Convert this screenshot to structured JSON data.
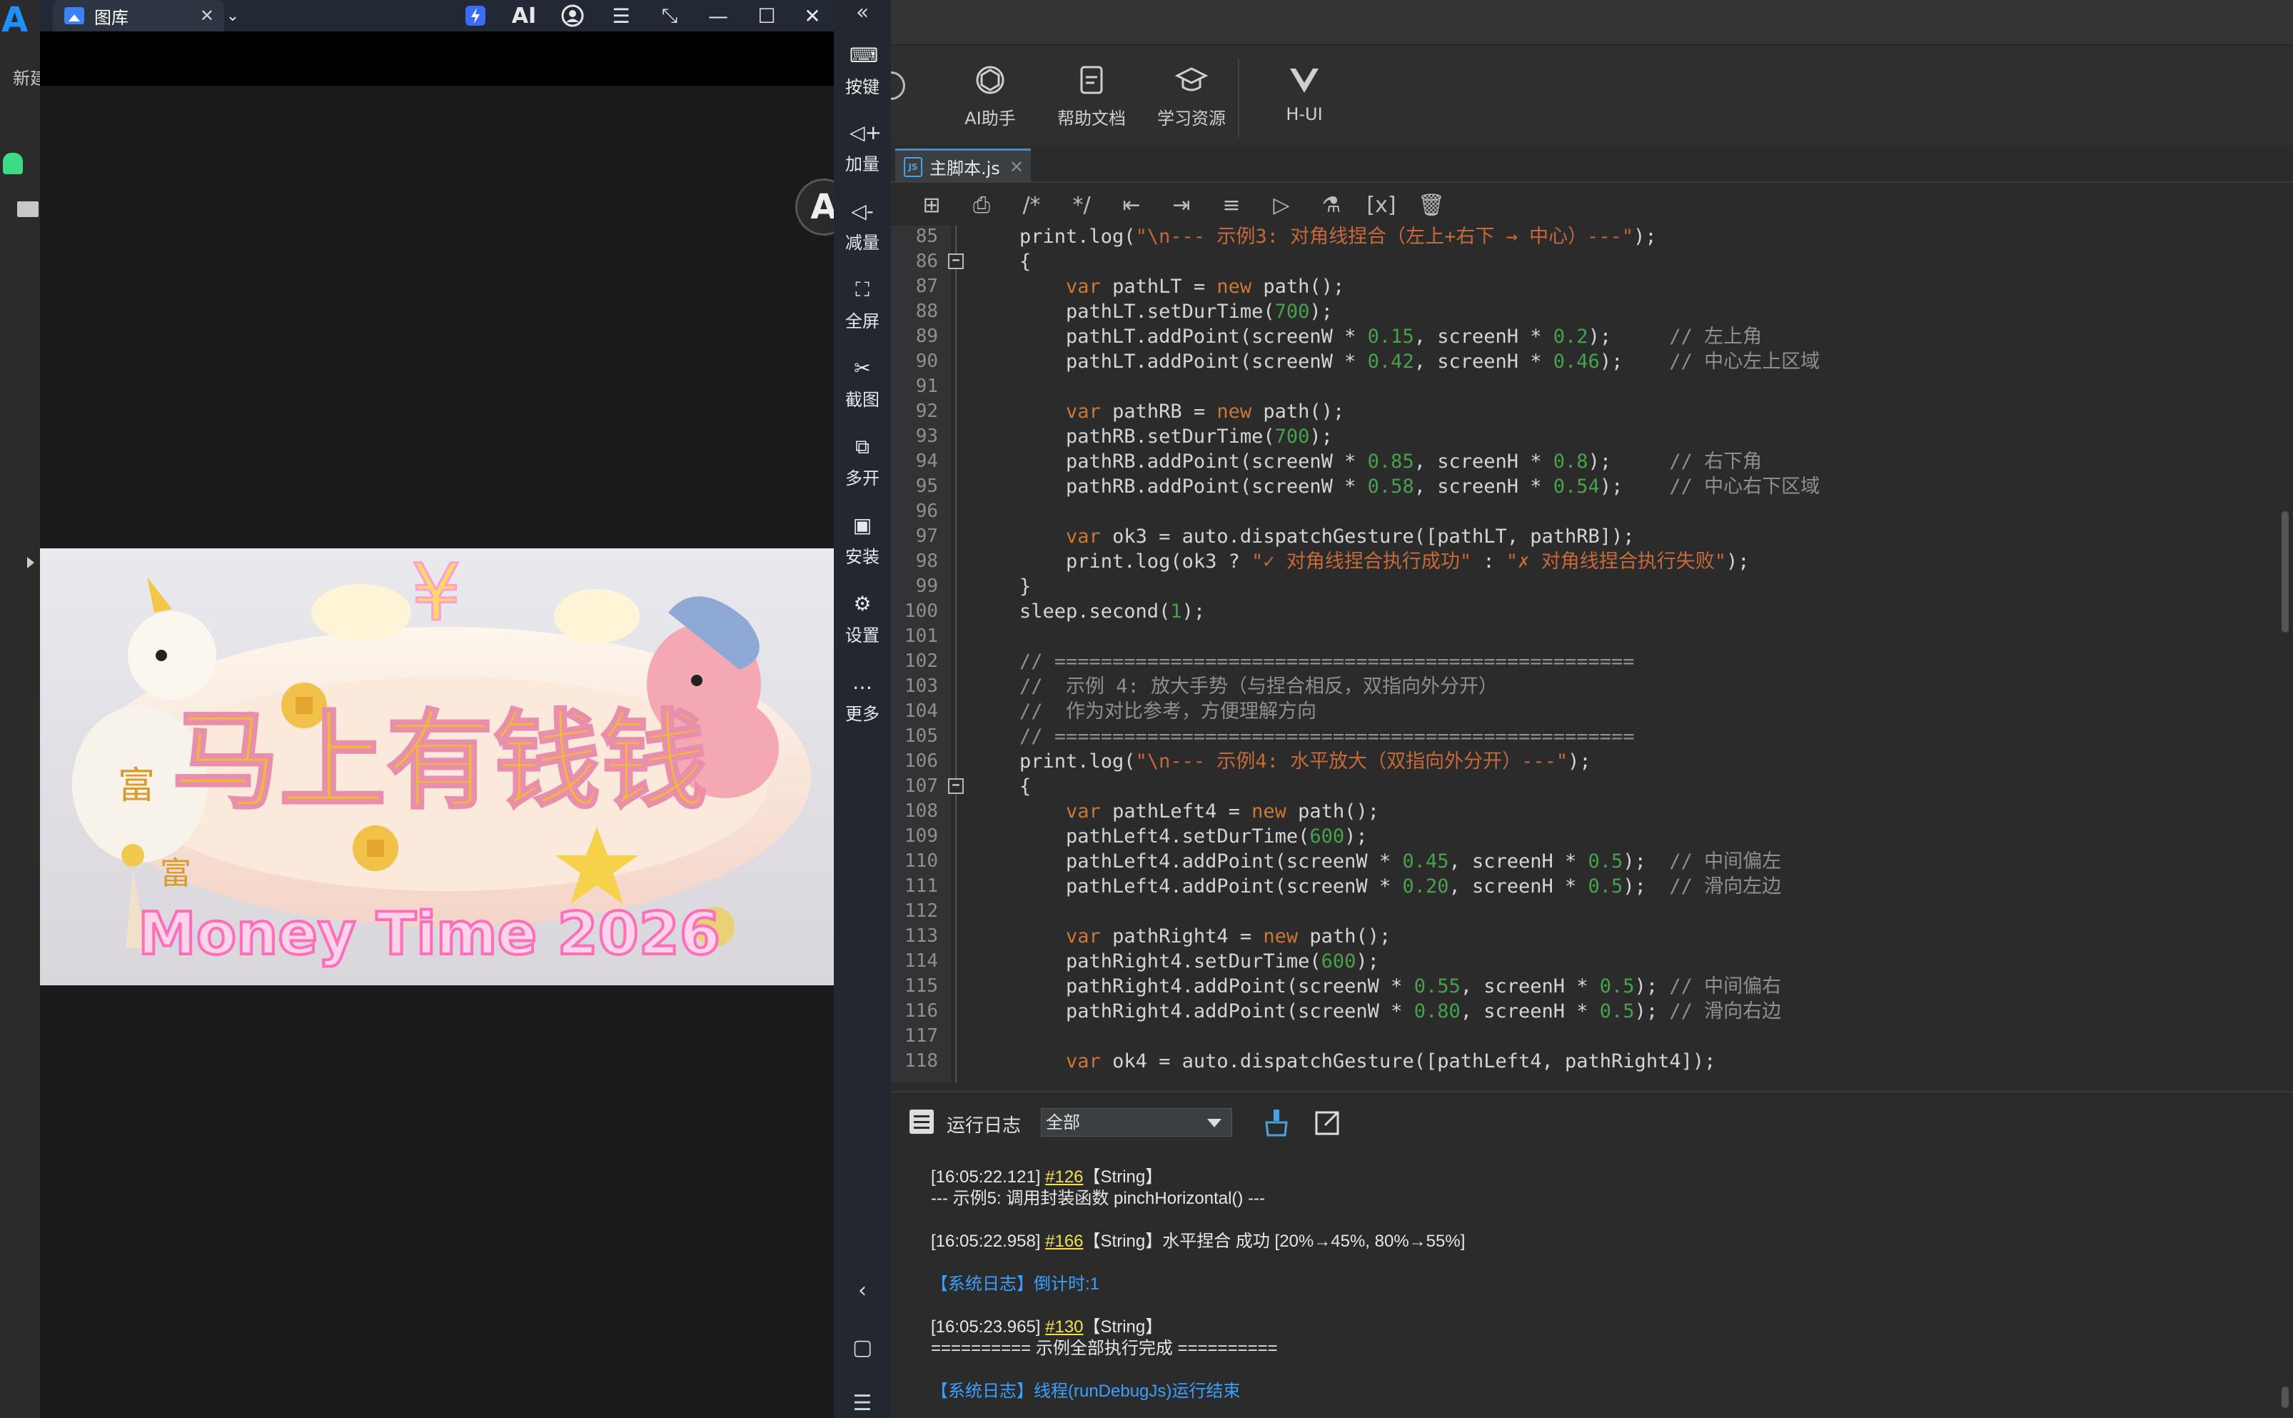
{
  "ide": {
    "logo": "A",
    "left_new_label": "新建",
    "toolbar": [
      {
        "label": "AI助手",
        "icon": "ai-assistant-icon"
      },
      {
        "label": "帮助文档",
        "icon": "document-icon"
      },
      {
        "label": "学习资源",
        "icon": "graduation-cap-icon"
      },
      {
        "label": "H-UI",
        "icon": "vue-icon"
      }
    ],
    "file_tab": "主脚本.js",
    "edit_toolbar_icons": [
      "add-icon",
      "print-icon",
      "comment-icon",
      "uncomment-icon",
      "outdent-icon",
      "indent-icon",
      "format-icon",
      "run-icon",
      "test-icon",
      "variable-icon",
      "delete-icon"
    ]
  },
  "emulator": {
    "tab_title": "图库",
    "side_items": [
      {
        "label": "按键",
        "icon": "keyboard-icon"
      },
      {
        "label": "加量",
        "icon": "volume-up-icon"
      },
      {
        "label": "减量",
        "icon": "volume-down-icon"
      },
      {
        "label": "全屏",
        "icon": "fullscreen-icon"
      },
      {
        "label": "截图",
        "icon": "scissors-icon"
      },
      {
        "label": "多开",
        "icon": "multi-instance-icon"
      },
      {
        "label": "安装",
        "icon": "apk-install-icon"
      },
      {
        "label": "设置",
        "icon": "settings-icon"
      },
      {
        "label": "更多",
        "icon": "more-icon"
      }
    ],
    "image_text": {
      "title": "马上有钱钱",
      "subtitle": "Money Time 2026",
      "fu": "富"
    }
  },
  "code": {
    "lines": [
      {
        "n": 85,
        "fold": false
      },
      {
        "n": 86,
        "fold": true
      },
      {
        "n": 87
      },
      {
        "n": 88
      },
      {
        "n": 89
      },
      {
        "n": 90
      },
      {
        "n": 91
      },
      {
        "n": 92
      },
      {
        "n": 93
      },
      {
        "n": 94
      },
      {
        "n": 95
      },
      {
        "n": 96
      },
      {
        "n": 97
      },
      {
        "n": 98
      },
      {
        "n": 99
      },
      {
        "n": 100
      },
      {
        "n": 101
      },
      {
        "n": 102
      },
      {
        "n": 103
      },
      {
        "n": 104
      },
      {
        "n": 105
      },
      {
        "n": 106
      },
      {
        "n": 107,
        "fold": true
      },
      {
        "n": 108
      },
      {
        "n": 109
      },
      {
        "n": 110
      },
      {
        "n": 111
      },
      {
        "n": 112
      },
      {
        "n": 113
      },
      {
        "n": 114
      },
      {
        "n": 115
      },
      {
        "n": 116
      },
      {
        "n": 117
      },
      {
        "n": 118
      }
    ],
    "text": [
      "print.log(\"\\n--- 示例3: 对角线捏合（左上+右下 → 中心）---\");",
      "{",
      "    var pathLT = new path();",
      "    pathLT.setDurTime(700);",
      "    pathLT.addPoint(screenW * 0.15, screenH * 0.2);     // 左上角",
      "    pathLT.addPoint(screenW * 0.42, screenH * 0.46);    // 中心左上区域",
      "",
      "    var pathRB = new path();",
      "    pathRB.setDurTime(700);",
      "    pathRB.addPoint(screenW * 0.85, screenH * 0.8);     // 右下角",
      "    pathRB.addPoint(screenW * 0.58, screenH * 0.54);    // 中心右下区域",
      "",
      "    var ok3 = auto.dispatchGesture([pathLT, pathRB]);",
      "    print.log(ok3 ? \"✓ 对角线捏合执行成功\" : \"✗ 对角线捏合执行失败\");",
      "}",
      "sleep.second(1);",
      "",
      "// ==================================================",
      "//  示例 4: 放大手势（与捏合相反，双指向外分开）",
      "//  作为对比参考，方便理解方向",
      "// ==================================================",
      "print.log(\"\\n--- 示例4: 水平放大（双指向外分开）---\");",
      "{",
      "    var pathLeft4 = new path();",
      "    pathLeft4.setDurTime(600);",
      "    pathLeft4.addPoint(screenW * 0.45, screenH * 0.5);  // 中间偏左",
      "    pathLeft4.addPoint(screenW * 0.20, screenH * 0.5);  // 滑向左边",
      "",
      "    var pathRight4 = new path();",
      "    pathRight4.setDurTime(600);",
      "    pathRight4.addPoint(screenW * 0.55, screenH * 0.5); // 中间偏右",
      "    pathRight4.addPoint(screenW * 0.80, screenH * 0.5); // 滑向右边",
      "",
      "    var ok4 = auto.dispatchGesture([pathLeft4, pathRight4]);"
    ]
  },
  "log": {
    "title": "运行日志",
    "filter": "全部",
    "entries": [
      {
        "time": "[16:05:22.121]",
        "link": "#126",
        "tag": "【String】",
        "text": ""
      },
      {
        "plain": "--- 示例5: 调用封装函数 pinchHorizontal() ---"
      },
      {
        "time": "[16:05:22.958]",
        "link": "#166",
        "tag": "【String】",
        "text": "水平捏合 成功 [20%→45%, 80%→55%]"
      },
      {
        "sys": "【系统日志】倒计时:1"
      },
      {
        "time": "[16:05:23.965]",
        "link": "#130",
        "tag": "【String】",
        "text": ""
      },
      {
        "plain": "========== 示例全部执行完成 =========="
      },
      {
        "sys": "【系统日志】线程(runDebugJs)运行结束"
      }
    ]
  }
}
